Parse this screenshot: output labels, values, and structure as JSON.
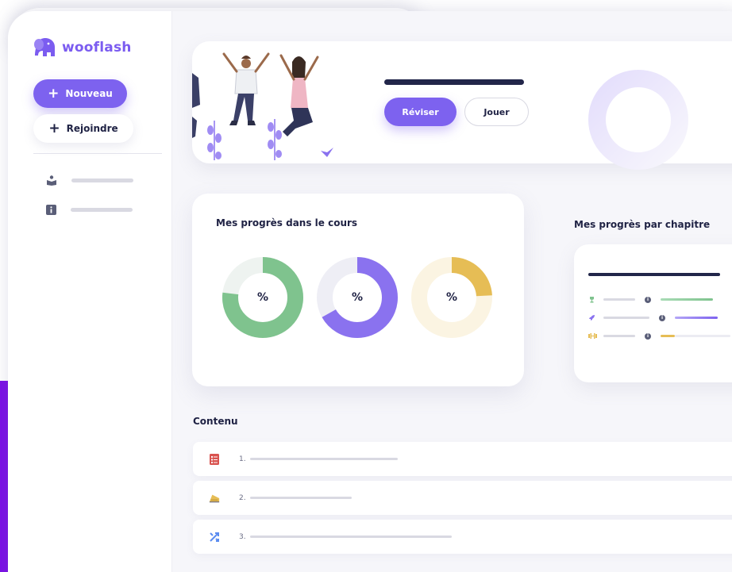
{
  "brand": {
    "name": "wooflash",
    "accent": "#7b5cf0"
  },
  "sidebar": {
    "new_button": "Nouveau",
    "join_button": "Rejoindre",
    "items": [
      {
        "icon": "reading-person-icon"
      },
      {
        "icon": "info-icon"
      }
    ]
  },
  "hero": {
    "revise_button": "Réviser",
    "play_button": "Jouer"
  },
  "progress_card": {
    "title": "Mes progrès dans le cours",
    "donuts": [
      {
        "label": "%",
        "color": "#7fc38e",
        "track": "#eef3f0"
      },
      {
        "label": "%",
        "color": "#8a72ef",
        "track": "#eeeef5"
      },
      {
        "label": "%",
        "color": "#e6bd55",
        "track": "#fbf4e2"
      }
    ]
  },
  "chapter_card": {
    "title": "Mes progrès par chapitre",
    "rows": [
      {
        "icon": "trophy-icon",
        "color": "#7fc38e"
      },
      {
        "icon": "rocket-icon",
        "color": "#8a72ef"
      },
      {
        "icon": "dumbbell-icon",
        "color": "#e6bd55"
      }
    ]
  },
  "content": {
    "title": "Contenu",
    "items": [
      {
        "num": "1.",
        "icon": "checklist-icon"
      },
      {
        "num": "2.",
        "icon": "ruler-icon"
      },
      {
        "num": "3.",
        "icon": "shuffle-icon"
      }
    ]
  }
}
